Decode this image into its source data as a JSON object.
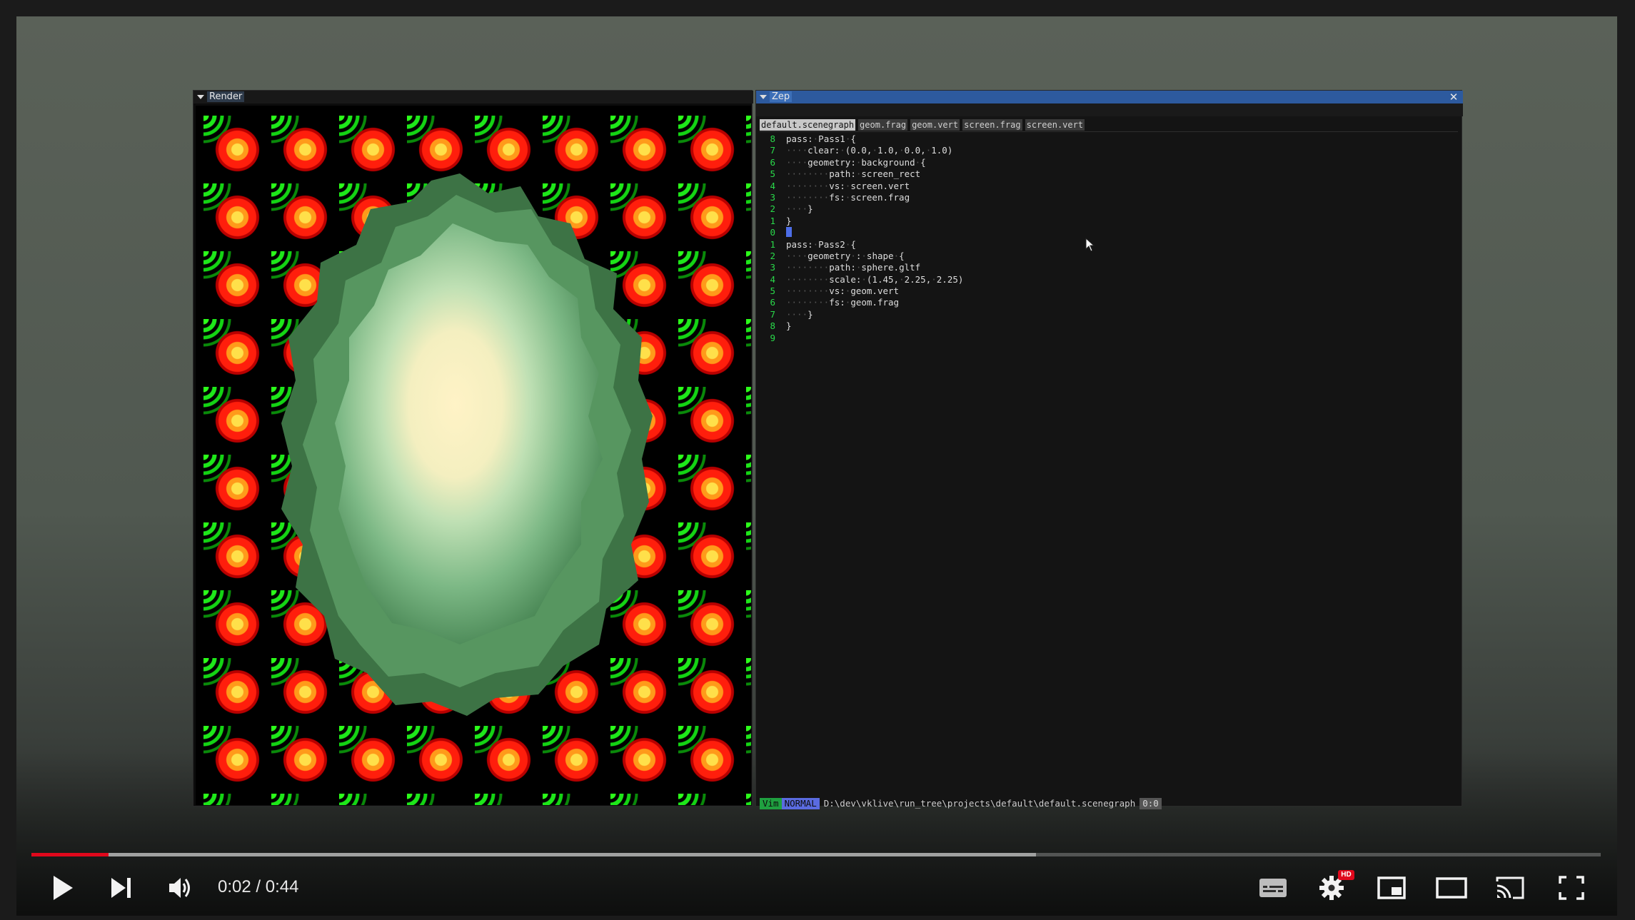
{
  "render_panel": {
    "title": "Render"
  },
  "zep_panel": {
    "title": "Zep",
    "close_glyph": "✕"
  },
  "tabs": [
    {
      "label": "default.scenegraph",
      "active": true
    },
    {
      "label": "geom.frag",
      "active": false
    },
    {
      "label": "geom.vert",
      "active": false
    },
    {
      "label": "screen.frag",
      "active": false
    },
    {
      "label": "screen.vert",
      "active": false
    }
  ],
  "code_lines": [
    {
      "num": "8",
      "text": "pass:·Pass1·{"
    },
    {
      "num": "7",
      "text": "····clear:·(0.0,·1.0,·0.0,·1.0)"
    },
    {
      "num": "6",
      "text": "····geometry:·background·{"
    },
    {
      "num": "5",
      "text": "········path:·screen_rect"
    },
    {
      "num": "4",
      "text": "········vs:·screen.vert"
    },
    {
      "num": "3",
      "text": "········fs:·screen.frag"
    },
    {
      "num": "2",
      "text": "····}"
    },
    {
      "num": "1",
      "text": "}"
    },
    {
      "num": "0",
      "text": ""
    },
    {
      "num": "1",
      "text": "pass:·Pass2·{"
    },
    {
      "num": "2",
      "text": "····geometry·:·shape·{"
    },
    {
      "num": "3",
      "text": "········path:·sphere.gltf"
    },
    {
      "num": "4",
      "text": "········scale:·(1.45,·2.25,·2.25)"
    },
    {
      "num": "5",
      "text": "········vs:·geom.vert"
    },
    {
      "num": "6",
      "text": "········fs:·geom.frag"
    },
    {
      "num": "7",
      "text": "····}"
    },
    {
      "num": "8",
      "text": "}"
    },
    {
      "num": "9",
      "text": ""
    }
  ],
  "cursor_line_index": 8,
  "status_bar": {
    "mode_vim": "Vim",
    "mode_normal": "NORMAL",
    "path": "D:\\dev\\vklive\\run_tree\\projects\\default\\default.scenegraph",
    "position": "0:0"
  },
  "player": {
    "time": "0:02 / 0:44",
    "played_fraction": 0.049,
    "buffered_fraction": 0.64,
    "hd_badge": "HD",
    "accent_color": "#e0081c"
  },
  "icons": {
    "play": "play-icon",
    "next": "skip-next-icon",
    "volume": "volume-icon",
    "subtitles": "subtitles-icon",
    "settings": "settings-gear-icon",
    "miniplayer": "miniplayer-icon",
    "theater": "theater-mode-icon",
    "cast": "cast-icon",
    "fullscreen": "fullscreen-icon"
  }
}
